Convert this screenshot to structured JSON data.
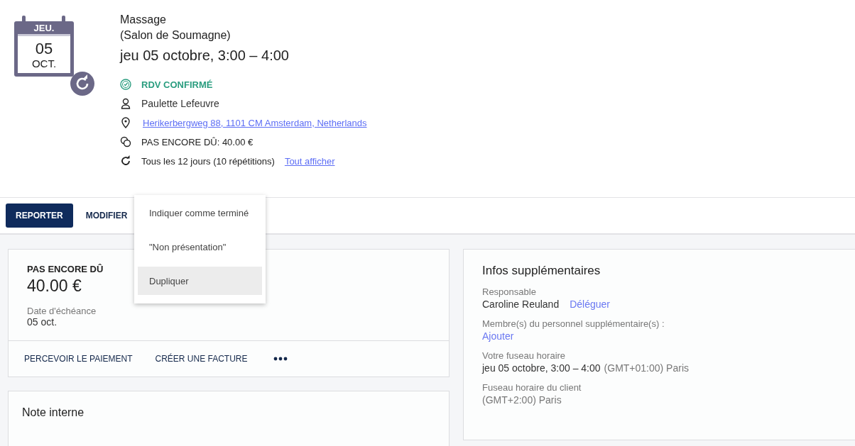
{
  "calendar_badge": {
    "weekday": "JEU.",
    "day": "05",
    "month": "OCT.",
    "recurring": true
  },
  "appointment": {
    "service": "Massage",
    "location": "(Salon de Soumagne)",
    "datetime": "jeu 05 octobre, 3:00 – 4:00"
  },
  "details": [
    {
      "kind": "status",
      "text": "RDV CONFIRMÉ"
    },
    {
      "kind": "client",
      "text": "Paulette Lefeuvre"
    },
    {
      "kind": "address",
      "text": "Herikerbergweg 88, 1101 CM Amsterdam, Netherlands"
    },
    {
      "kind": "payment",
      "text": "PAS ENCORE DÛ: 40.00 €"
    },
    {
      "kind": "repeat",
      "text": "Tous les 12 jours (10 répétitions)",
      "link_text": "Tout afficher"
    }
  ],
  "toolbar": [
    {
      "label": "REPORTER",
      "primary": true
    },
    {
      "label": "MODIFIER",
      "primary": false
    }
  ],
  "menu": [
    {
      "label": "Indiquer comme terminé",
      "selected": false
    },
    {
      "label": "\"Non présentation\"",
      "selected": false
    },
    {
      "label": "Dupliquer",
      "selected": true
    }
  ],
  "payment_card": {
    "title": "PAS ENCORE DÛ",
    "amount": "40.00 €",
    "due_label": "Date d'échéance",
    "due_value": "05 oct.",
    "actions": [
      "PERCEVOIR LE PAIEMENT",
      "CRÉER UNE FACTURE"
    ]
  },
  "note_card": {
    "title": "Note interne"
  },
  "info_card": {
    "title": "Infos supplémentaires",
    "fields": [
      {
        "label": "Responsable",
        "value": "Caroline Reuland",
        "link": "Déléguer"
      },
      {
        "label": "Membre(s) du personnel supplémentaire(s) :",
        "link": "Ajouter"
      },
      {
        "label": "Votre fuseau horaire",
        "value": "jeu 05 octobre, 3:00 – 4:00",
        "note": "(GMT+01:00) Paris"
      },
      {
        "label": "Fuseau horaire du client",
        "note": "(GMT+2:00) Paris"
      }
    ]
  }
}
